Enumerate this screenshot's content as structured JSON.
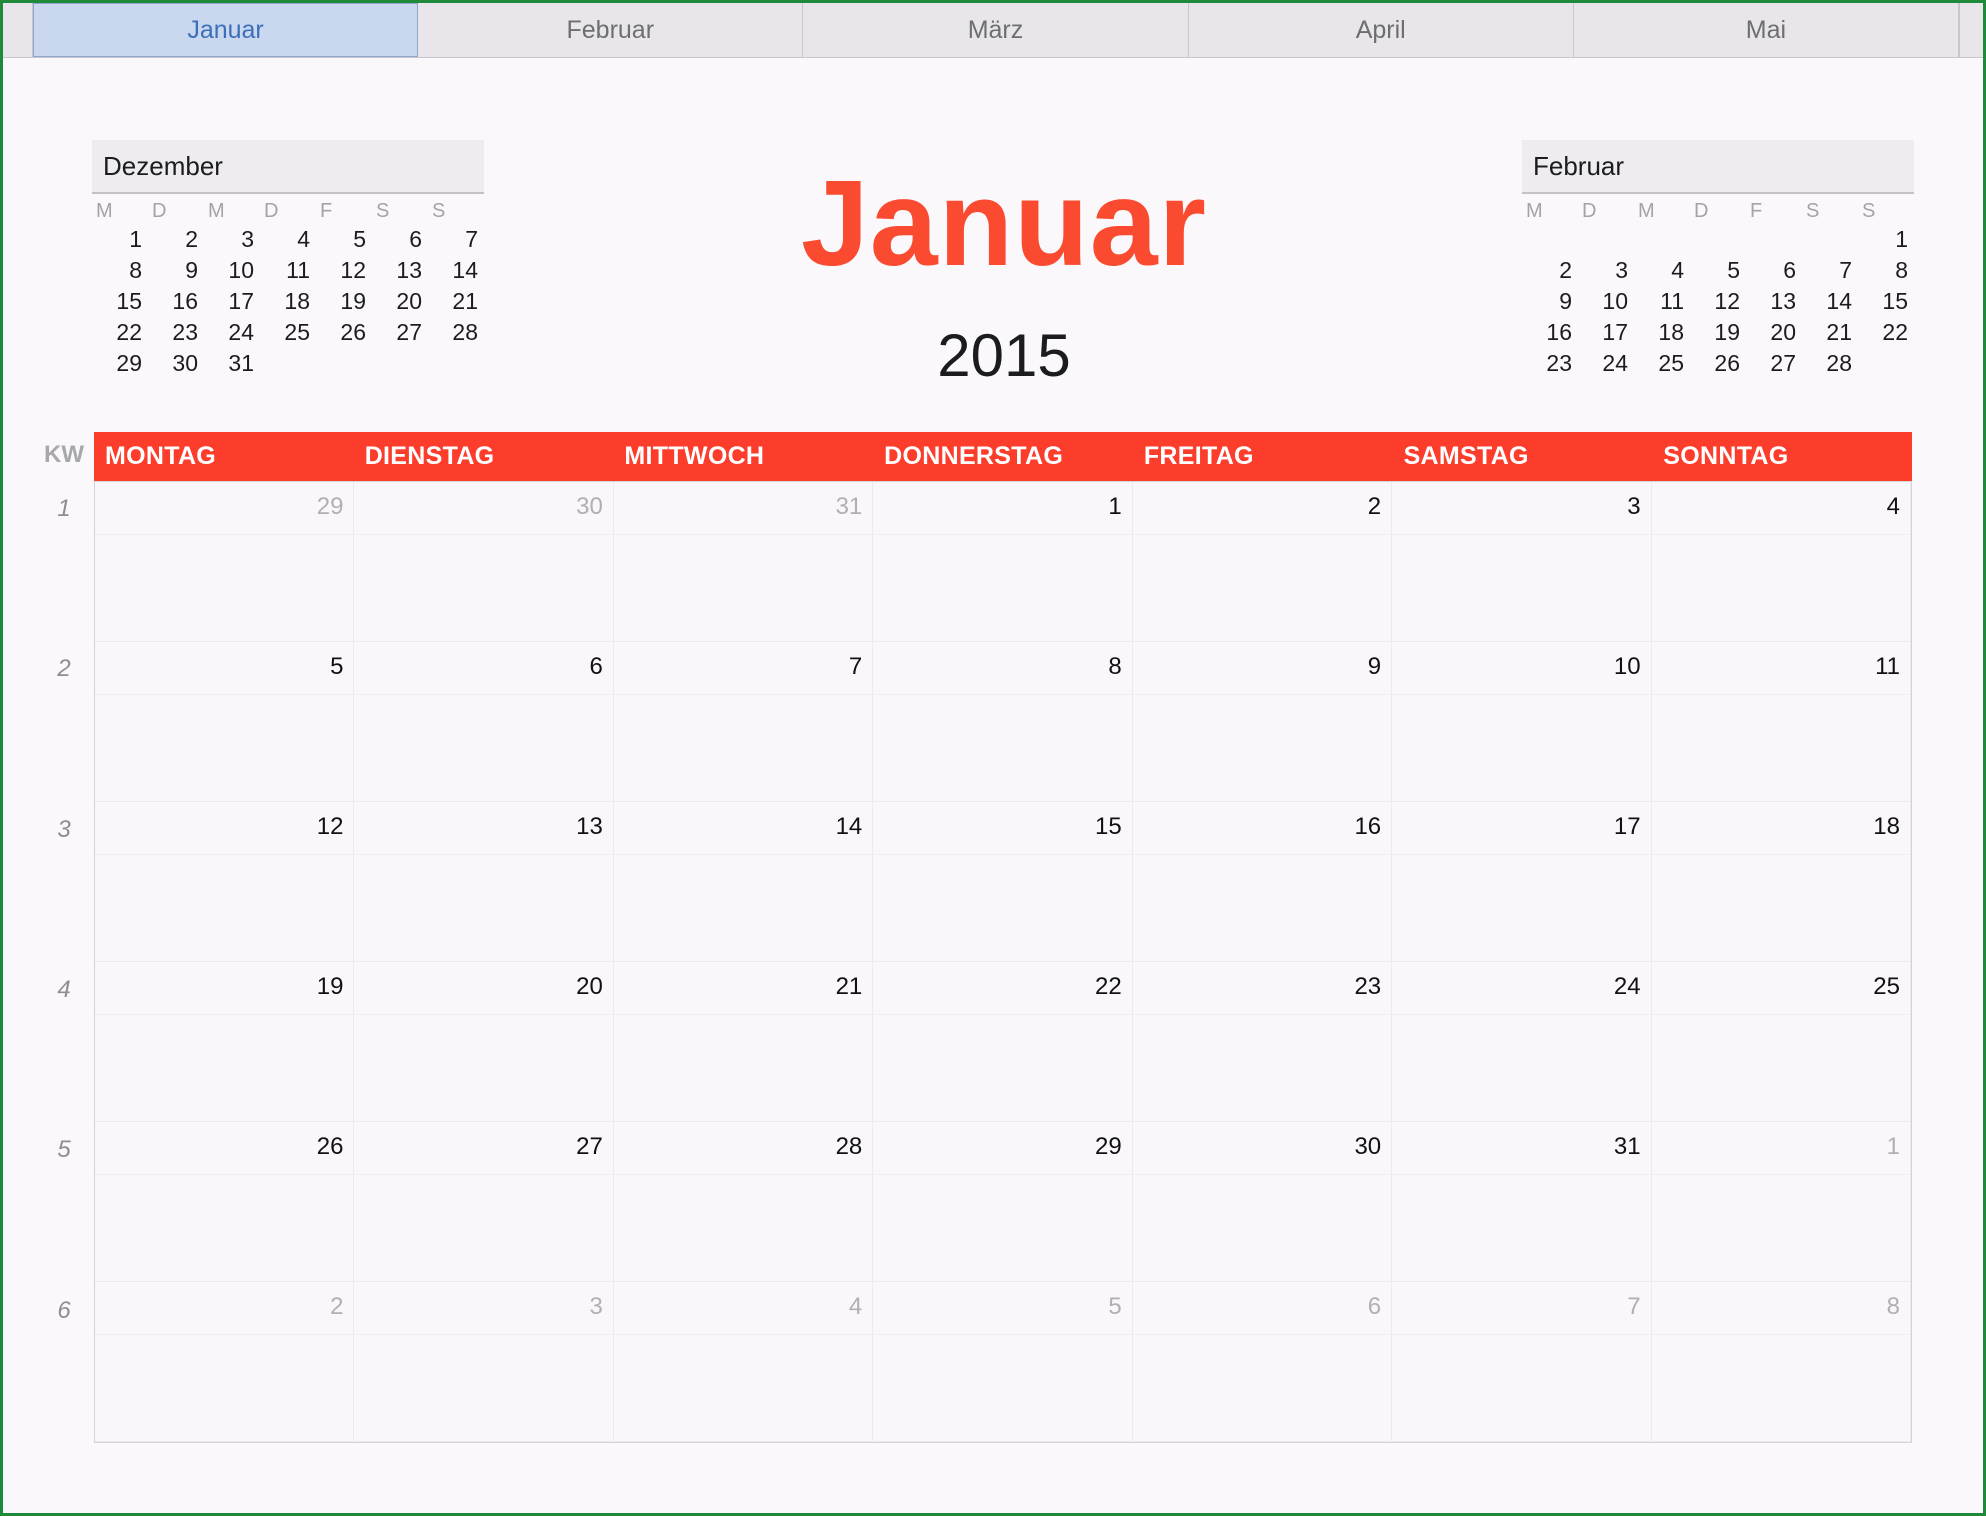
{
  "tabs": [
    "Januar",
    "Februar",
    "März",
    "April",
    "Mai"
  ],
  "active_tab": 0,
  "title": "Januar",
  "year": "2015",
  "kw_label": "KW",
  "weekdays": [
    "MONTAG",
    "DIENSTAG",
    "MITTWOCH",
    "DONNERSTAG",
    "FREITAG",
    "SAMSTAG",
    "SONNTAG"
  ],
  "week_numbers": [
    "1",
    "2",
    "3",
    "4",
    "5",
    "6"
  ],
  "days": [
    {
      "d": "29",
      "muted": true
    },
    {
      "d": "30",
      "muted": true
    },
    {
      "d": "31",
      "muted": true
    },
    {
      "d": "1"
    },
    {
      "d": "2"
    },
    {
      "d": "3"
    },
    {
      "d": "4"
    },
    {
      "d": "5"
    },
    {
      "d": "6"
    },
    {
      "d": "7"
    },
    {
      "d": "8"
    },
    {
      "d": "9"
    },
    {
      "d": "10"
    },
    {
      "d": "11"
    },
    {
      "d": "12"
    },
    {
      "d": "13"
    },
    {
      "d": "14"
    },
    {
      "d": "15"
    },
    {
      "d": "16"
    },
    {
      "d": "17"
    },
    {
      "d": "18"
    },
    {
      "d": "19"
    },
    {
      "d": "20"
    },
    {
      "d": "21"
    },
    {
      "d": "22"
    },
    {
      "d": "23"
    },
    {
      "d": "24"
    },
    {
      "d": "25"
    },
    {
      "d": "26"
    },
    {
      "d": "27"
    },
    {
      "d": "28"
    },
    {
      "d": "29"
    },
    {
      "d": "30"
    },
    {
      "d": "31"
    },
    {
      "d": "1",
      "muted": true
    },
    {
      "d": "2",
      "muted": true
    },
    {
      "d": "3",
      "muted": true
    },
    {
      "d": "4",
      "muted": true
    },
    {
      "d": "5",
      "muted": true
    },
    {
      "d": "6",
      "muted": true
    },
    {
      "d": "7",
      "muted": true
    },
    {
      "d": "8",
      "muted": true
    }
  ],
  "mini_prev": {
    "title": "Dezember",
    "dow": [
      "M",
      "D",
      "M",
      "D",
      "F",
      "S",
      "S"
    ],
    "cells": [
      "1",
      "2",
      "3",
      "4",
      "5",
      "6",
      "7",
      "8",
      "9",
      "10",
      "11",
      "12",
      "13",
      "14",
      "15",
      "16",
      "17",
      "18",
      "19",
      "20",
      "21",
      "22",
      "23",
      "24",
      "25",
      "26",
      "27",
      "28",
      "29",
      "30",
      "31",
      "",
      "",
      "",
      ""
    ]
  },
  "mini_next": {
    "title": "Februar",
    "dow": [
      "M",
      "D",
      "M",
      "D",
      "F",
      "S",
      "S"
    ],
    "cells": [
      "",
      "",
      "",
      "",
      "",
      "",
      "1",
      "2",
      "3",
      "4",
      "5",
      "6",
      "7",
      "8",
      "9",
      "10",
      "11",
      "12",
      "13",
      "14",
      "15",
      "16",
      "17",
      "18",
      "19",
      "20",
      "21",
      "22",
      "23",
      "24",
      "25",
      "26",
      "27",
      "28",
      ""
    ]
  },
  "colors": {
    "accent": "#fc3d2c",
    "title": "#fa4a30",
    "active_tab": "#c9d7ef",
    "frame": "#1f8a3a"
  }
}
